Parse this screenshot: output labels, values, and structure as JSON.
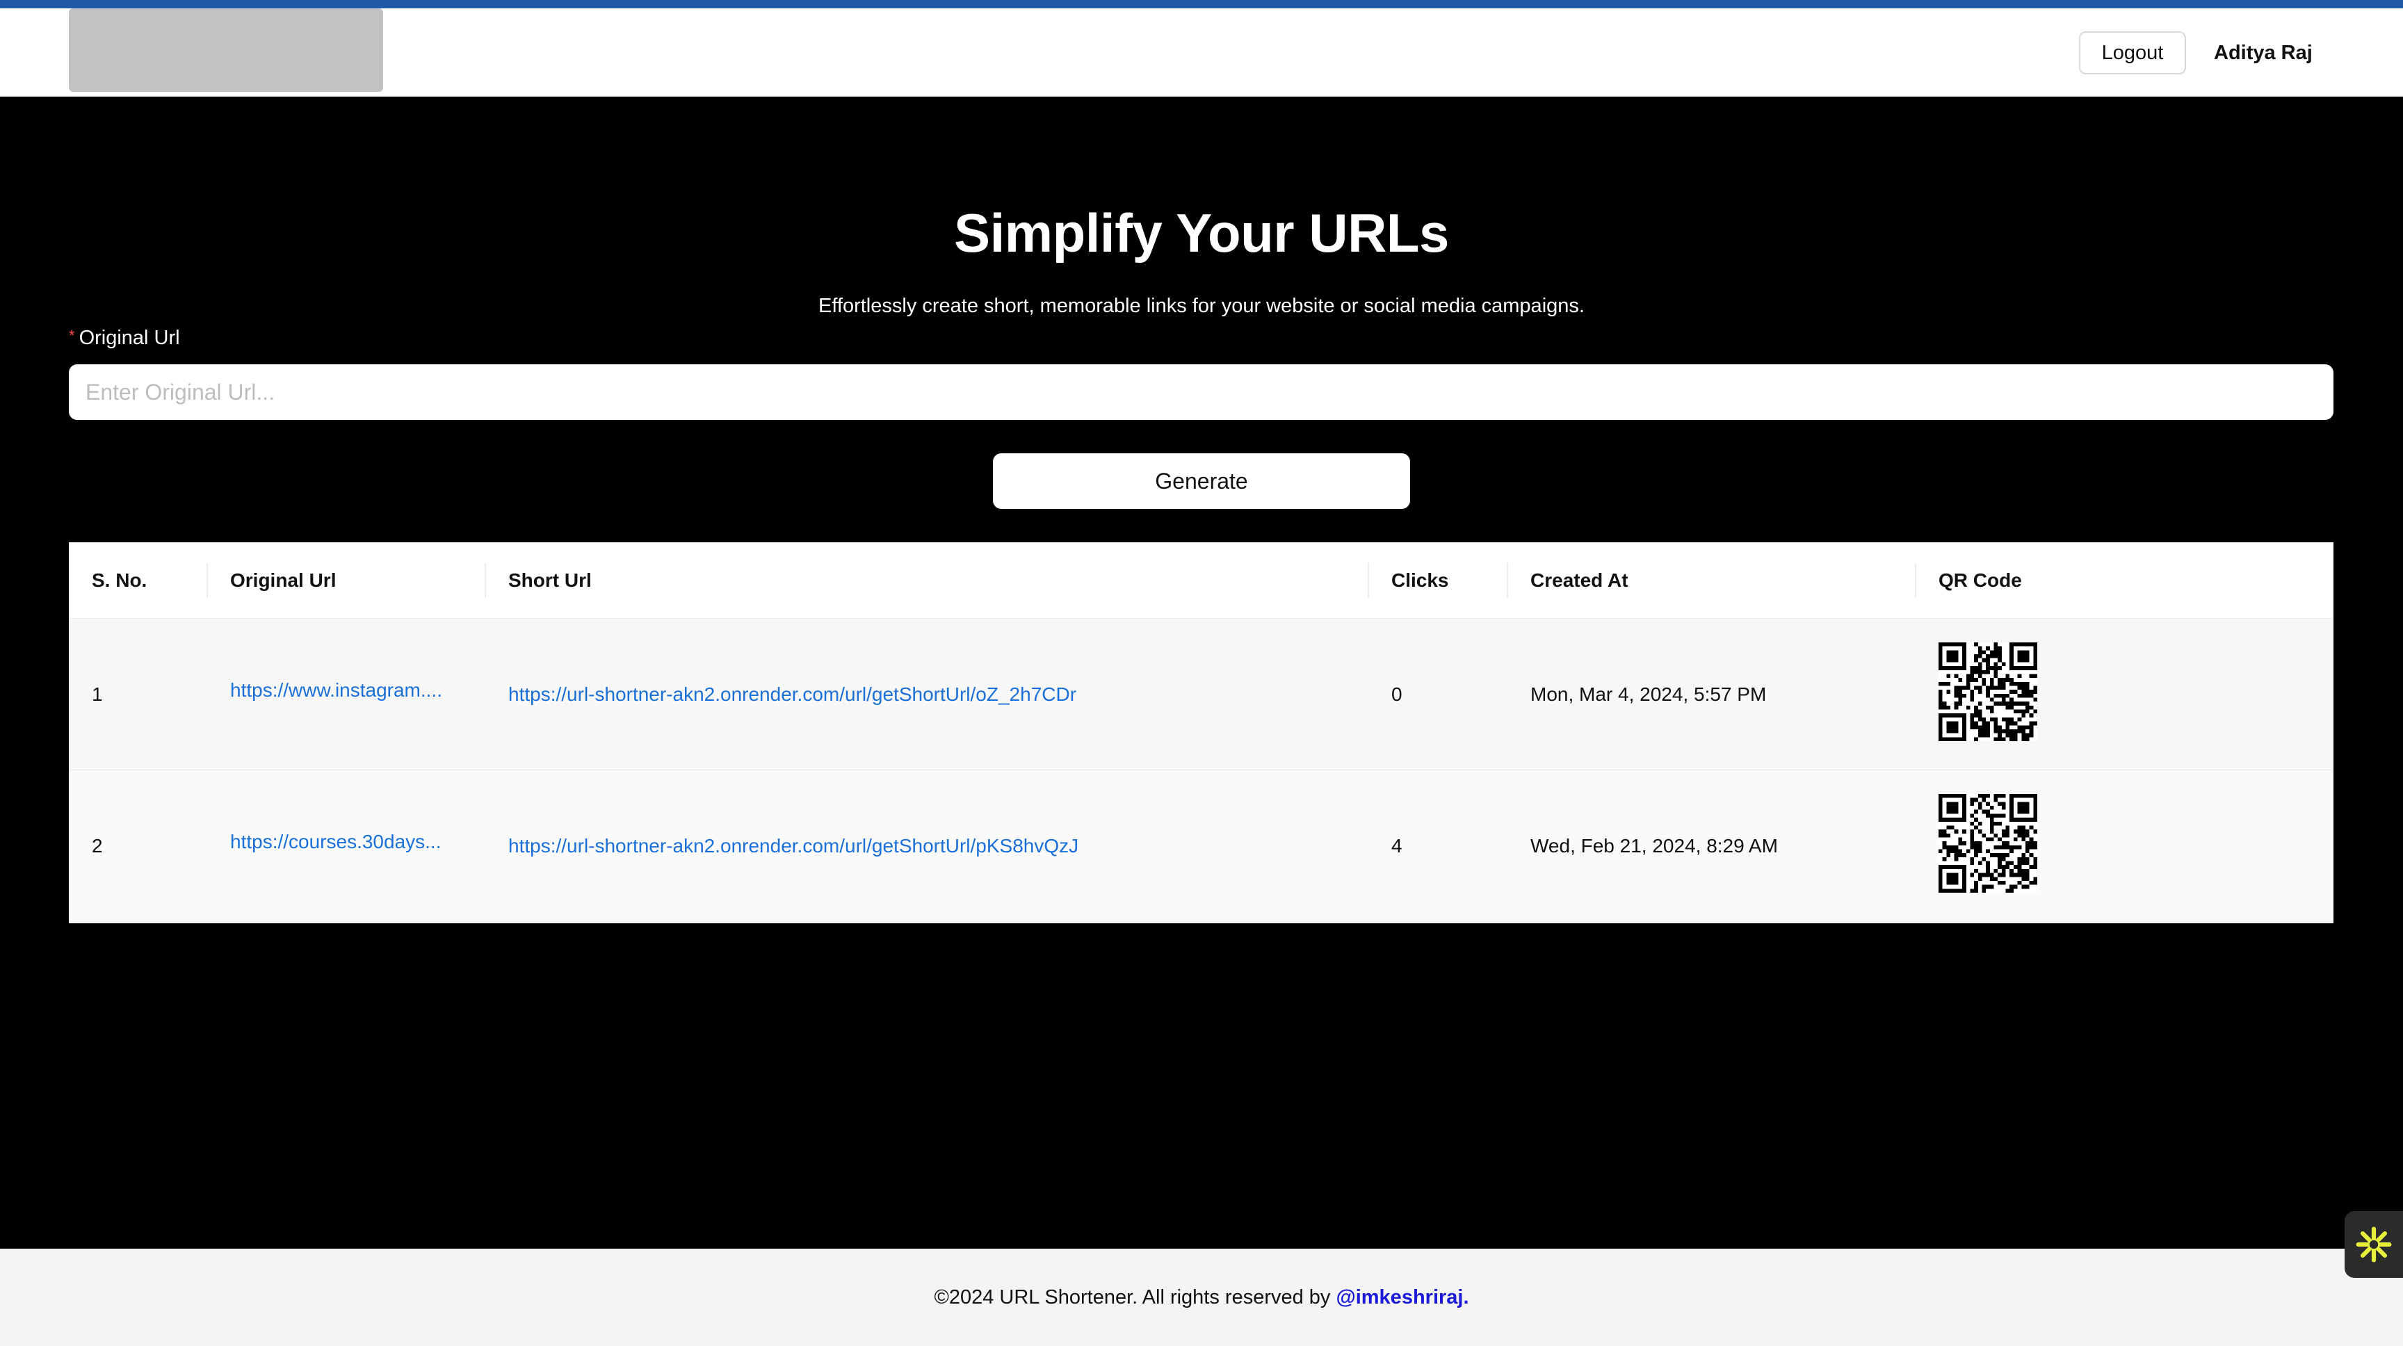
{
  "header": {
    "logout_label": "Logout",
    "user_name": "Aditya Raj"
  },
  "hero": {
    "title": "Simplify Your URLs",
    "subtitle": "Effortlessly create short, memorable links for your website or social media campaigns."
  },
  "form": {
    "required_mark": "*",
    "label": "Original Url",
    "placeholder": "Enter Original Url...",
    "value": "",
    "generate_label": "Generate"
  },
  "table": {
    "columns": [
      "S. No.",
      "Original Url",
      "Short Url",
      "Clicks",
      "Created At",
      "QR Code"
    ],
    "rows": [
      {
        "sno": "1",
        "original": "https://www.instagram....",
        "short": "https://url-shortner-akn2.onrender.com/url/getShortUrl/oZ_2h7CDr",
        "clicks": "0",
        "created": "Mon, Mar 4, 2024, 5:57 PM",
        "qr_icon": "qr-code-icon"
      },
      {
        "sno": "2",
        "original": "https://courses.30days...",
        "short": "https://url-shortner-akn2.onrender.com/url/getShortUrl/pKS8hvQzJ",
        "clicks": "4",
        "created": "Wed, Feb 21, 2024, 8:29 AM",
        "qr_icon": "qr-code-icon"
      }
    ]
  },
  "footer": {
    "text": "©2024 URL Shortener. All rights reserved by",
    "handle": "@imkeshriraj."
  },
  "colors": {
    "accent_bar": "#1f5aa6",
    "link": "#1a6fd8",
    "background": "#000000",
    "fab_icon": "#e6f03c"
  },
  "icons": {
    "fab": "sparkle-icon"
  }
}
